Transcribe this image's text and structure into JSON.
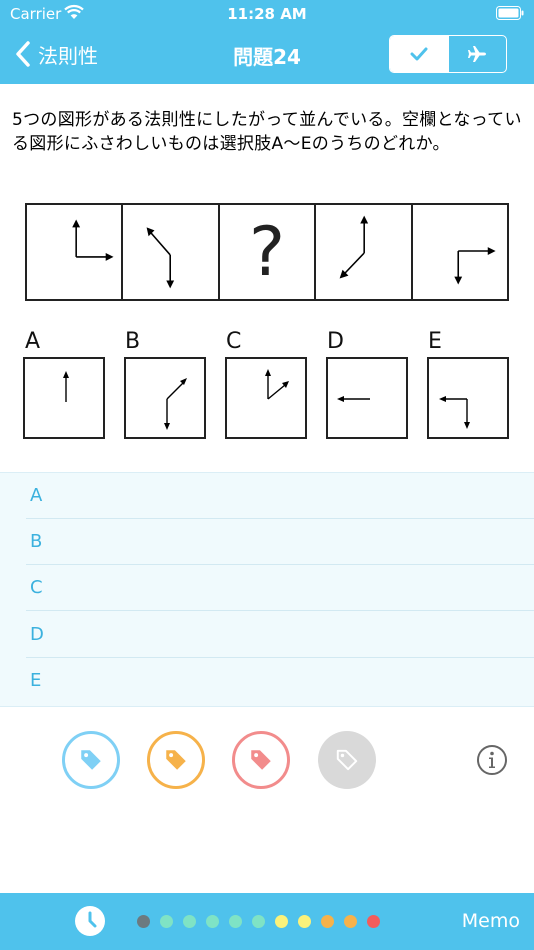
{
  "status": {
    "carrier": "Carrier",
    "time": "11:28 AM"
  },
  "nav": {
    "back_label": "法則性",
    "title": "問題24",
    "segment": [
      {
        "icon": "check-icon",
        "selected": true
      },
      {
        "icon": "airplane-icon",
        "selected": false
      }
    ]
  },
  "question": {
    "text": "5つの図形がある法則性にしたがって並んでいる。空欄となっている図形にふさわしいものは選択肢A～Eのうちのどれか。",
    "blank_symbol": "?"
  },
  "options": [
    {
      "letter": "A"
    },
    {
      "letter": "B"
    },
    {
      "letter": "C"
    },
    {
      "letter": "D"
    },
    {
      "letter": "E"
    }
  ],
  "answers": [
    {
      "label": "A"
    },
    {
      "label": "B"
    },
    {
      "label": "C"
    },
    {
      "label": "D"
    },
    {
      "label": "E"
    }
  ],
  "tags": [
    {
      "icon": "tag-icon",
      "color": "#7fd0f5",
      "filled": false
    },
    {
      "icon": "tag-icon",
      "color": "#f6b24a",
      "filled": false
    },
    {
      "icon": "tag-icon",
      "color": "#f28c8c",
      "filled": false
    },
    {
      "icon": "tag-icon",
      "color": "#d9d9d9",
      "filled": true
    }
  ],
  "footer": {
    "memo_label": "Memo",
    "progress_dots": [
      "#6c7a80",
      "#7fe3c5",
      "#7fe3c5",
      "#7fe3c5",
      "#7fe3c5",
      "#7fe3c5",
      "#fbf27a",
      "#fbf27a",
      "#f6b24a",
      "#f6b24a",
      "#f25c5c"
    ]
  },
  "colors": {
    "accent": "#4fc2ec",
    "answer_text": "#3bb1de"
  }
}
